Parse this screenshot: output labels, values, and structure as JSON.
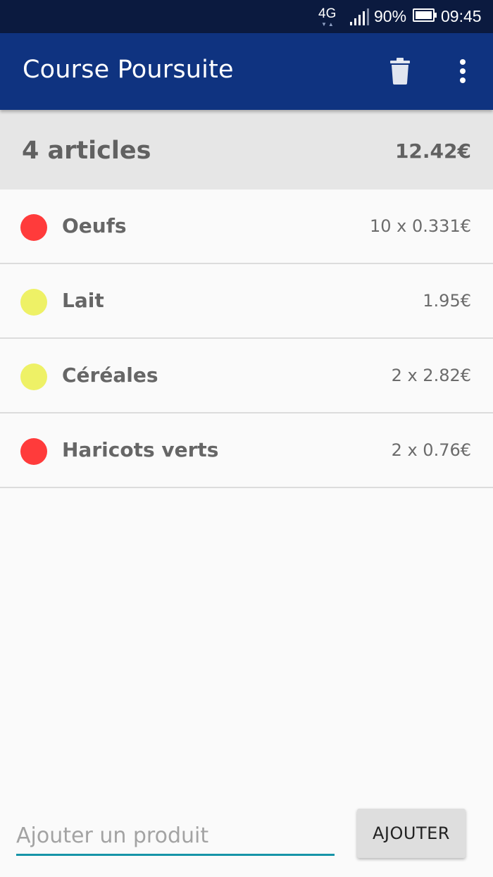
{
  "status_bar": {
    "network": "4G",
    "battery_percent": "90%",
    "time": "09:45"
  },
  "app_bar": {
    "title": "Course Poursuite",
    "actions": [
      "trash-icon",
      "more-vert-icon"
    ]
  },
  "summary": {
    "count": "4 articles",
    "total": "12.42€"
  },
  "items": [
    {
      "name": "Oeufs",
      "price": "10 x 0.331€",
      "color": "#ff3b3b"
    },
    {
      "name": "Lait",
      "price": "1.95€",
      "color": "#eef166"
    },
    {
      "name": "Céréales",
      "price": "2 x 2.82€",
      "color": "#eef166"
    },
    {
      "name": "Haricots verts",
      "price": "2 x 0.76€",
      "color": "#ff3b3b"
    }
  ],
  "add_product": {
    "placeholder": "Ajouter un produit",
    "value": "",
    "button_label": "AJOUTER"
  },
  "colors": {
    "status_bar": "#0b1a3f",
    "app_bar": "#0f3380",
    "input_underline": "#1694a8"
  }
}
